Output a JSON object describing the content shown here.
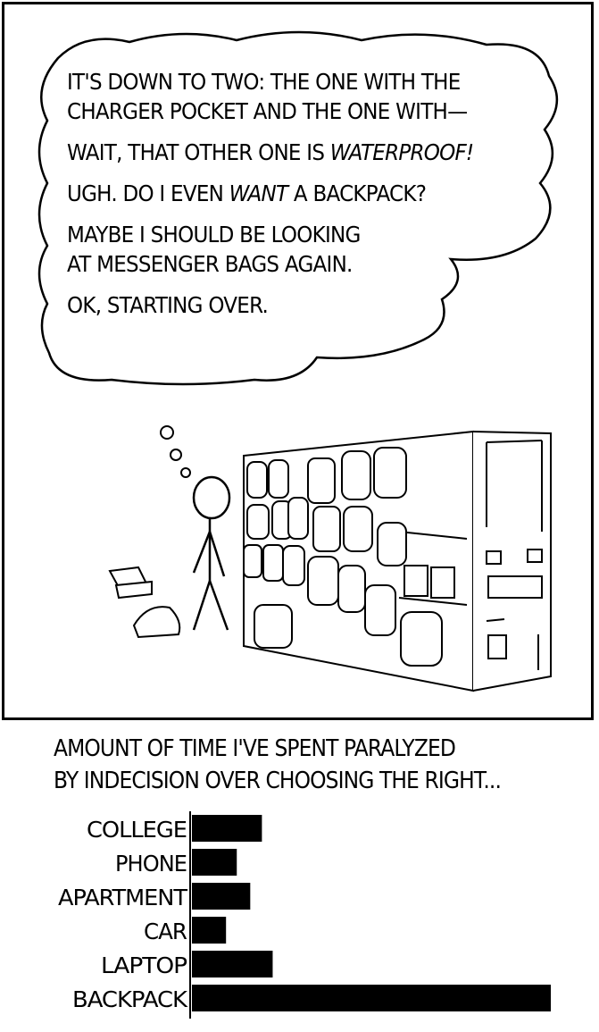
{
  "thought": {
    "paragraphs": [
      {
        "lines": [
          "IT'S DOWN TO TWO: THE ONE WITH THE",
          "CHARGER POCKET AND THE ONE WITH—"
        ]
      },
      {
        "lines": [
          "WAIT, THAT OTHER ONE IS "
        ],
        "emph": "WATERPROOF!"
      },
      {
        "lines": [
          "UGH. DO I EVEN "
        ],
        "emph": "WANT",
        "after": " A BACKPACK?"
      },
      {
        "lines": [
          "MAYBE I SHOULD BE LOOKING",
          "AT MESSENGER BAGS AGAIN."
        ]
      },
      {
        "lines": [
          "OK, STARTING OVER."
        ]
      }
    ]
  },
  "chart_title": {
    "line1": "AMOUNT OF TIME I'VE SPENT PARALYZED",
    "line2": "BY INDECISION OVER CHOOSING THE RIGHT..."
  },
  "chart_data": {
    "type": "bar",
    "orientation": "horizontal",
    "title": "AMOUNT OF TIME I'VE SPENT PARALYZED BY INDECISION OVER CHOOSING THE RIGHT...",
    "categories": [
      "COLLEGE",
      "PHONE",
      "APARTMENT",
      "CAR",
      "LAPTOP",
      "BACKPACK"
    ],
    "values": [
      78,
      50,
      65,
      38,
      90,
      400
    ],
    "xlim": [
      0,
      400
    ],
    "axis_ticks": false,
    "grid": false,
    "bar_color": "#000000"
  }
}
